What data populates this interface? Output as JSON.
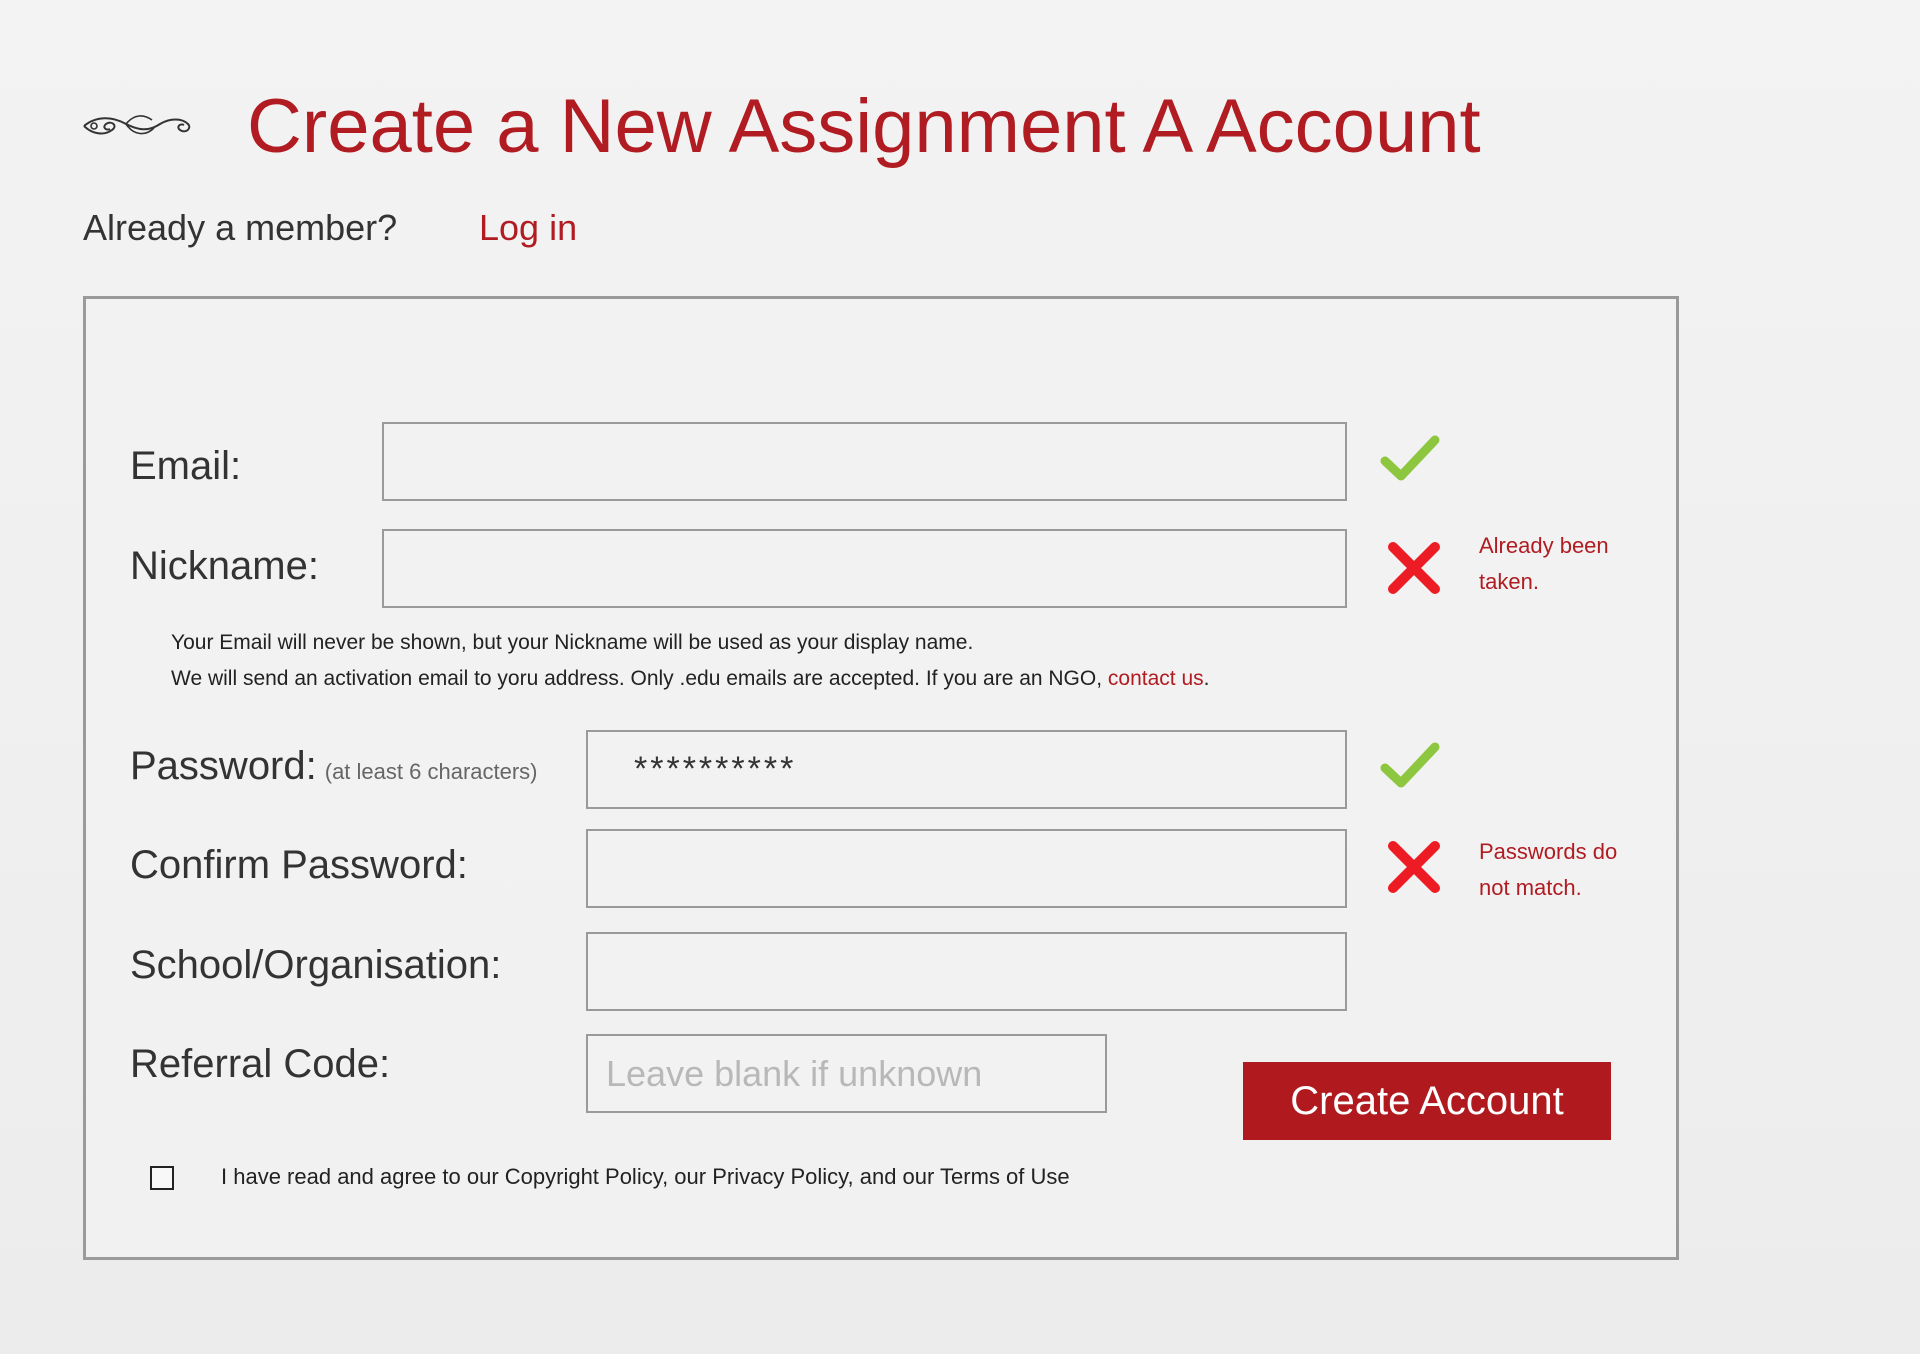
{
  "header": {
    "title": "Create a New Assignment A Account",
    "member_prompt": "Already a member?",
    "login_link": "Log in"
  },
  "form": {
    "email": {
      "label": "Email:",
      "value": "",
      "status": "valid"
    },
    "nickname": {
      "label": "Nickname:",
      "value": "",
      "status": "invalid",
      "error": "Already been taken."
    },
    "info_note": {
      "line1": "Your Email will never be shown, but your Nickname will be used as your display name.",
      "line2_prefix": "We will send an activation email to yoru address. Only .edu emails are accepted. If you are an NGO, ",
      "contact_link": "contact us",
      "line2_suffix": "."
    },
    "password": {
      "label": "Password:",
      "hint": "(at least 6 characters)",
      "value": "**********",
      "status": "valid"
    },
    "confirm_password": {
      "label": "Confirm Password:",
      "value": "",
      "status": "invalid",
      "error": "Passwords do not match."
    },
    "school": {
      "label": "School/Organisation:",
      "value": ""
    },
    "referral": {
      "label": "Referral Code:",
      "placeholder": "Leave blank if unknown",
      "value": ""
    },
    "submit_label": "Create Account",
    "agree": {
      "checked": false,
      "text": "I have read and agree to our Copyright Policy, our Privacy Policy, and our Terms of Use"
    }
  },
  "icons": {
    "valid": "checkmark-icon",
    "invalid": "cross-icon",
    "decoration": "flourish-icon"
  },
  "colors": {
    "brand": "#b01c22",
    "valid": "#8dc63f",
    "invalid": "#ed1c24",
    "border": "#9a9a9a",
    "background": "#f1f1f1"
  }
}
